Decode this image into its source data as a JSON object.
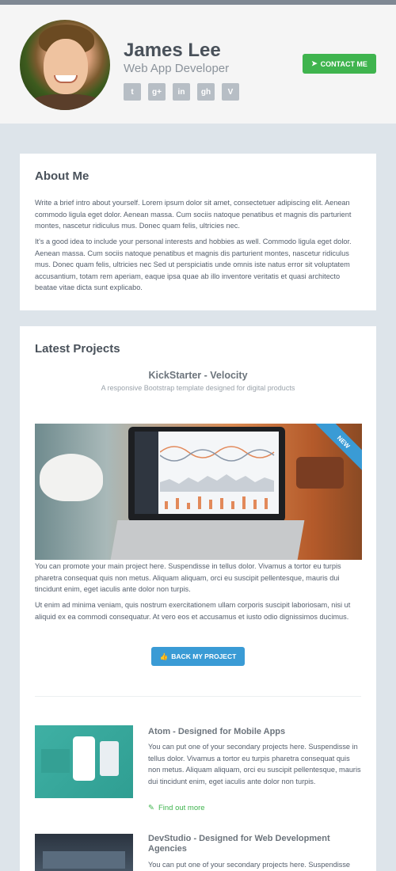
{
  "header": {
    "name": "James Lee",
    "role": "Web App Developer",
    "social": [
      {
        "icon": "twitter-icon",
        "glyph": "t"
      },
      {
        "icon": "google-plus-icon",
        "glyph": "g+"
      },
      {
        "icon": "linkedin-icon",
        "glyph": "in"
      },
      {
        "icon": "github-icon",
        "glyph": "gh"
      },
      {
        "icon": "vimeo-icon",
        "glyph": "V"
      }
    ],
    "contact_label": "CONTACT ME",
    "contact_color": "#3fb44e"
  },
  "about": {
    "title": "About Me",
    "p1": "Write a brief intro about yourself. Lorem ipsum dolor sit amet, consectetuer adipiscing elit. Aenean commodo ligula eget dolor. Aenean massa. Cum sociis natoque penatibus et magnis dis parturient montes, nascetur ridiculus mus. Donec quam felis, ultricies nec.",
    "p2": "It's a good idea to include your personal interests and hobbies as well. Commodo ligula eget dolor. Aenean massa. Cum sociis natoque penatibus et magnis dis parturient montes, nascetur ridiculus mus. Donec quam felis, ultricies nec Sed ut perspiciatis unde omnis iste natus error sit voluptatem accusantium, totam rem aperiam, eaque ipsa quae ab illo inventore veritatis et quasi architecto beatae vitae dicta sunt explicabo."
  },
  "projects": {
    "title": "Latest Projects",
    "featured": {
      "title": "KickStarter - Velocity",
      "subtitle": "A responsive Bootstrap template designed for digital products",
      "badge": "NEW",
      "p1": "You can promote your main project here. Suspendisse in tellus dolor. Vivamus a tortor eu turpis pharetra consequat quis non metus. Aliquam aliquam, orci eu suscipit pellentesque, mauris dui tincidunt enim, eget iaculis ante dolor non turpis.",
      "p2": "Ut enim ad minima veniam, quis nostrum exercitationem ullam corporis suscipit laboriosam, nisi ut aliquid ex ea commodi consequatur. At vero eos et accusamus et iusto odio dignissimos ducimus.",
      "button_label": "BACK MY PROJECT",
      "button_color": "#3a9bd5"
    },
    "items": [
      {
        "title": "Atom - Designed for Mobile Apps",
        "text": "You can put one of your secondary projects here. Suspendisse in tellus dolor. Vivamus a tortor eu turpis pharetra consequat quis non metus. Aliquam aliquam, orci eu suscipit pellentesque, mauris dui tincidunt enim, eget iaculis ante dolor non turpis.",
        "link": "Find out more"
      },
      {
        "title": "DevStudio - Designed for Web Development Agencies",
        "text": "You can put one of your secondary projects here. Suspendisse"
      }
    ]
  }
}
